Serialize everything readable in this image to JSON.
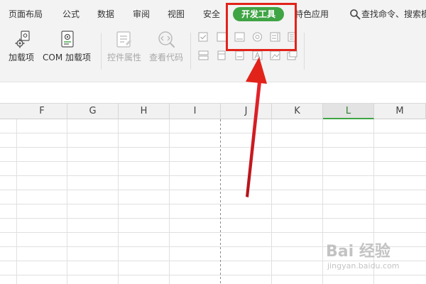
{
  "ribbon": {
    "tabs": [
      {
        "label": "页面布局",
        "active": false
      },
      {
        "label": "公式",
        "active": false
      },
      {
        "label": "数据",
        "active": false
      },
      {
        "label": "审阅",
        "active": false
      },
      {
        "label": "视图",
        "active": false
      },
      {
        "label": "安全",
        "active": false
      },
      {
        "label": "开发工具",
        "active": true
      },
      {
        "label": "特色应用",
        "active": false
      }
    ],
    "search_label": "查找命令、搜索模",
    "buttons": {
      "addins": {
        "label": "加载项",
        "icon": "gear-document-icon"
      },
      "com_addins": {
        "label": "COM 加载项",
        "icon": "gear-document-icon"
      },
      "control_properties": {
        "label": "控件属性",
        "icon": "properties-icon",
        "disabled": true
      },
      "view_code": {
        "label": "查看代码",
        "icon": "code-magnifier-icon",
        "disabled": true
      }
    },
    "control_icons": [
      "checkbox-control-icon",
      "textbox-control-icon",
      "label-control-icon",
      "radio-control-icon",
      "listbox-control-icon",
      "scrollbar-control-icon",
      "button-control-icon",
      "combobox-control-icon",
      "frame-control-icon",
      "image-control-icon",
      "spin-control-icon",
      "toggle-control-icon"
    ]
  },
  "sheet": {
    "columns": [
      "F",
      "G",
      "H",
      "I",
      "J",
      "K",
      "L",
      "M"
    ],
    "selected_column": "L"
  },
  "watermark": {
    "text": "Bai 经验",
    "url": "jingyan.baidu.com"
  },
  "colors": {
    "accent_green": "#3fa444",
    "highlight_red": "#e2231a"
  }
}
